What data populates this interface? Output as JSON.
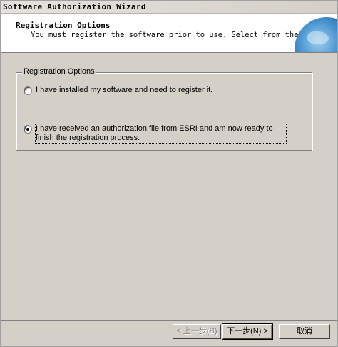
{
  "window": {
    "title": "Software Authorization Wizard"
  },
  "header": {
    "title": "Registration Options",
    "subtitle": "You must register the software prior to use. Select from the options below."
  },
  "options": {
    "group_label": "Registration Options",
    "items": [
      {
        "label": "I have installed my software and need to register it.",
        "checked": false
      },
      {
        "label": "I have received an authorization file from ESRI and am now ready to finish the registration process.",
        "checked": true
      }
    ]
  },
  "buttons": {
    "back": "< 上一步(B)",
    "next": "下一步(N) >",
    "cancel": "取消"
  }
}
